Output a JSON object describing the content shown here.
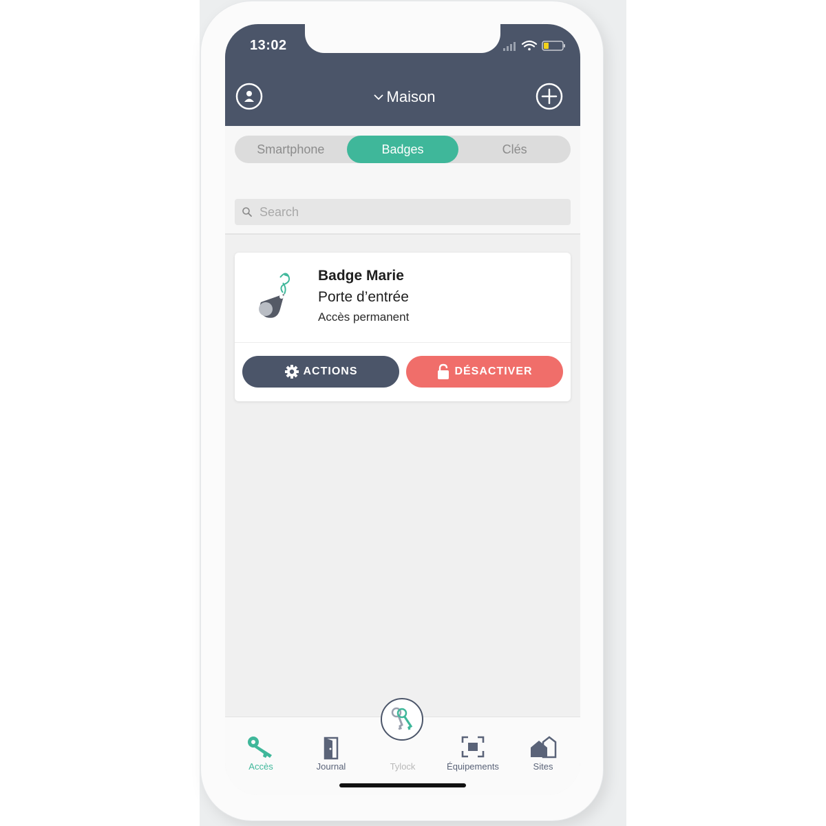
{
  "status_bar": {
    "time": "13:02"
  },
  "header": {
    "site_name": "Maison"
  },
  "segments": [
    {
      "label": "Smartphone",
      "active": false
    },
    {
      "label": "Badges",
      "active": true
    },
    {
      "label": "Clés",
      "active": false
    }
  ],
  "search": {
    "placeholder": "Search"
  },
  "badge_card": {
    "title": "Badge Marie",
    "door": "Porte d’entrée",
    "access": "Accès permanent",
    "actions_label": "ACTIONS",
    "deactivate_label": "DÉSACTIVER"
  },
  "tabbar": {
    "acces": "Accès",
    "journal": "Journal",
    "tylock": "Tylock",
    "equipements": "Équipements",
    "sites": "Sites"
  },
  "colors": {
    "header": "#4b5569",
    "accent": "#3fb79a",
    "danger": "#f06e6a"
  }
}
